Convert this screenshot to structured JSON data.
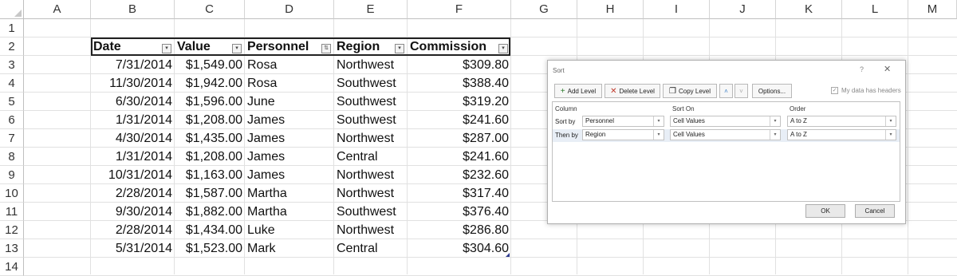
{
  "spreadsheet": {
    "column_letters": [
      "A",
      "B",
      "C",
      "D",
      "E",
      "F",
      "G",
      "H",
      "I",
      "J",
      "K",
      "L",
      "M"
    ],
    "row_numbers": [
      "1",
      "2",
      "3",
      "4",
      "5",
      "6",
      "7",
      "8",
      "9",
      "10",
      "11",
      "12",
      "13",
      "14"
    ],
    "headers": [
      "Date",
      "Value",
      "Personnel",
      "Region",
      "Commission"
    ],
    "rows": [
      [
        "7/31/2014",
        "$1,549.00",
        "Rosa",
        "Northwest",
        "$309.80"
      ],
      [
        "11/30/2014",
        "$1,942.00",
        "Rosa",
        "Southwest",
        "$388.40"
      ],
      [
        "6/30/2014",
        "$1,596.00",
        "June",
        "Southwest",
        "$319.20"
      ],
      [
        "1/31/2014",
        "$1,208.00",
        "James",
        "Southwest",
        "$241.60"
      ],
      [
        "4/30/2014",
        "$1,435.00",
        "James",
        "Northwest",
        "$287.00"
      ],
      [
        "1/31/2014",
        "$1,208.00",
        "James",
        "Central",
        "$241.60"
      ],
      [
        "10/31/2014",
        "$1,163.00",
        "James",
        "Northwest",
        "$232.60"
      ],
      [
        "2/28/2014",
        "$1,587.00",
        "Martha",
        "Northwest",
        "$317.40"
      ],
      [
        "9/30/2014",
        "$1,882.00",
        "Martha",
        "Southwest",
        "$376.40"
      ],
      [
        "2/28/2014",
        "$1,434.00",
        "Luke",
        "Northwest",
        "$286.80"
      ],
      [
        "5/31/2014",
        "$1,523.00",
        "Mark",
        "Central",
        "$304.60"
      ]
    ]
  },
  "sort_dialog": {
    "title": "Sort",
    "help": "?",
    "close": "✕",
    "add_level": "Add Level",
    "delete_level": "Delete Level",
    "copy_level": "Copy Level",
    "move_up": "˄",
    "move_down": "˅",
    "options": "Options...",
    "my_data_has_headers": "My data has headers",
    "headers_checked": true,
    "col_header": "Column",
    "sort_on_header": "Sort On",
    "order_header": "Order",
    "levels": [
      {
        "label": "Sort by",
        "column": "Personnel",
        "sort_on": "Cell Values",
        "order": "A to Z"
      },
      {
        "label": "Then by",
        "column": "Region",
        "sort_on": "Cell Values",
        "order": "A to Z"
      }
    ],
    "ok": "OK",
    "cancel": "Cancel"
  }
}
